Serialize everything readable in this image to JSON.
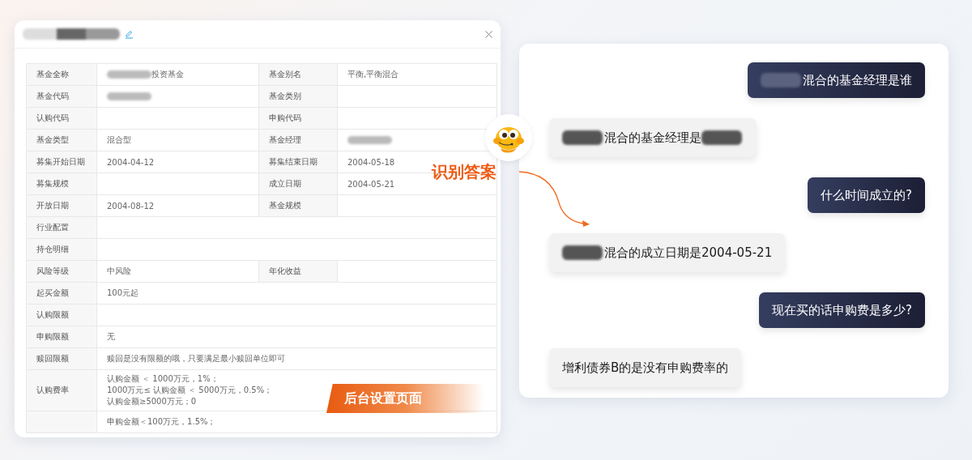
{
  "dialog": {
    "title_masked": true
  },
  "table": {
    "rows": [
      {
        "kind": "pair",
        "label": "基金全称",
        "value": "投资基金",
        "masked": true,
        "label2": "基金别名",
        "value2": "平衡,平衡混合"
      },
      {
        "kind": "pair",
        "label": "基金代码",
        "masked": true,
        "label2": "基金类别"
      },
      {
        "kind": "pair",
        "label": "认购代码",
        "label2": "申购代码"
      },
      {
        "kind": "pair",
        "label": "基金类型",
        "value": "混合型",
        "label2": "基金经理",
        "masked2": true
      },
      {
        "kind": "pair",
        "label": "募集开始日期",
        "value": "2004-04-12",
        "label2": "募集结束日期",
        "value2": "2004-05-18"
      },
      {
        "kind": "pair",
        "label": "募集规模",
        "label2": "成立日期",
        "value2": "2004-05-21"
      },
      {
        "kind": "pair",
        "label": "开放日期",
        "value": "2004-08-12",
        "label2": "基金规模"
      },
      {
        "kind": "wide",
        "label": "行业配置"
      },
      {
        "kind": "wide",
        "label": "持仓明细"
      },
      {
        "kind": "pair",
        "label": "风险等级",
        "value": "中风险",
        "label2": "年化收益"
      },
      {
        "kind": "wide",
        "label": "起买金额",
        "value": "100元起"
      },
      {
        "kind": "wide",
        "label": "认购限额"
      },
      {
        "kind": "wide",
        "label": "申购限额",
        "value": "无"
      },
      {
        "kind": "wide",
        "label": "赎回限额",
        "value": "赎回是没有限额的哦，只要满足最小赎回单位即可"
      },
      {
        "kind": "wide",
        "label": "认购费率",
        "lines": [
          "认购金额 ＜ 1000万元，1%；",
          "1000万元≤ 认购金额 ＜ 5000万元，0.5%；",
          "认购金额≥5000万元；0"
        ]
      },
      {
        "kind": "wide",
        "lines": [
          "申购金额＜100万元，1.5%；"
        ]
      }
    ]
  },
  "chat": {
    "messages": [
      {
        "kind": "question",
        "parts": [
          {
            "kind": "mask"
          },
          {
            "kind": "text",
            "text": "混合的基金经理是谁"
          }
        ]
      },
      {
        "kind": "answer",
        "parts": [
          {
            "kind": "mask"
          },
          {
            "kind": "text",
            "text": "混合的基金经理是"
          },
          {
            "kind": "mask"
          }
        ]
      },
      {
        "kind": "question",
        "parts": [
          {
            "kind": "text",
            "text": "什么时间成立的?"
          }
        ]
      },
      {
        "kind": "answer",
        "parts": [
          {
            "kind": "mask"
          },
          {
            "kind": "text",
            "text": "混合的成立日期是2004-05-21"
          }
        ]
      },
      {
        "kind": "question",
        "parts": [
          {
            "kind": "text",
            "text": "现在买的话申购费是多少?"
          }
        ]
      },
      {
        "kind": "answer",
        "parts": [
          {
            "kind": "text",
            "text": "增利债券B的是没有申购费率的"
          }
        ]
      }
    ]
  },
  "callout": {
    "label": "识别答案"
  },
  "badge": {
    "label": "后台设置页面"
  }
}
